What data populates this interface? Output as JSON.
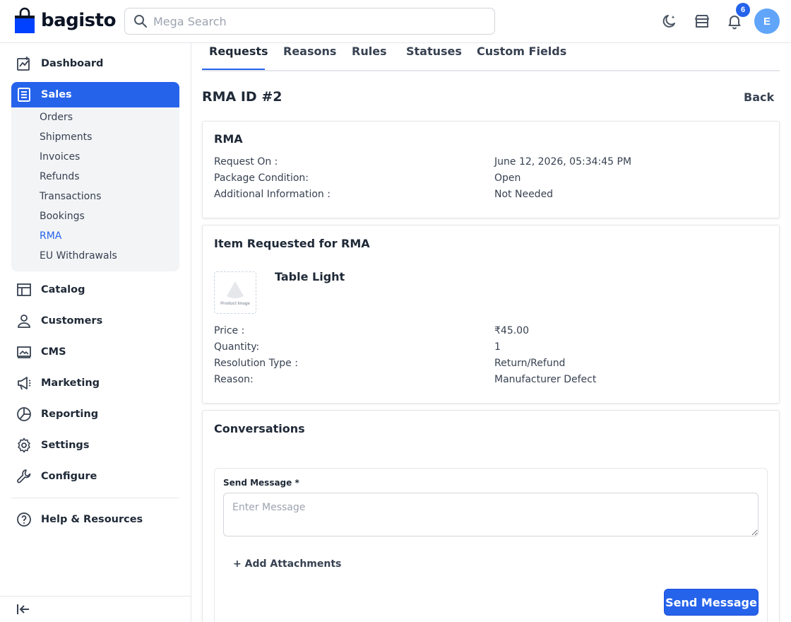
{
  "header": {
    "brand": "bagisto",
    "search_placeholder": "Mega Search",
    "notification_count": "6",
    "avatar_initial": "E",
    "icons": [
      "moon-icon",
      "store-icon",
      "bell-icon"
    ]
  },
  "sidebar": {
    "items": [
      {
        "label": "Dashboard",
        "icon": "dashboard-icon"
      },
      {
        "label": "Sales",
        "icon": "sales-icon",
        "active": true
      },
      {
        "label": "Catalog",
        "icon": "catalog-icon"
      },
      {
        "label": "Customers",
        "icon": "customers-icon"
      },
      {
        "label": "CMS",
        "icon": "cms-icon"
      },
      {
        "label": "Marketing",
        "icon": "marketing-icon"
      },
      {
        "label": "Reporting",
        "icon": "reporting-icon"
      },
      {
        "label": "Settings",
        "icon": "settings-icon"
      },
      {
        "label": "Configure",
        "icon": "configure-icon"
      },
      {
        "label": "Help & Resources",
        "icon": "help-icon"
      }
    ],
    "sales_submenu": [
      "Orders",
      "Shipments",
      "Invoices",
      "Refunds",
      "Transactions",
      "Bookings",
      "RMA",
      "EU Withdrawals"
    ],
    "active_submenu": "RMA"
  },
  "tabs": [
    "Requests",
    "Reasons",
    "Rules",
    "Statuses",
    "Custom Fields"
  ],
  "active_tab": "Requests",
  "page": {
    "title": "RMA ID #2",
    "back_label": "Back"
  },
  "rma_card": {
    "title": "RMA",
    "rows": [
      {
        "label": "Request On :",
        "value": "June 12, 2026, 05:34:45 PM"
      },
      {
        "label": "Package Condition:",
        "value": "Open"
      },
      {
        "label": "Additional Information :",
        "value": "Not Needed"
      }
    ]
  },
  "item_card": {
    "title": "Item Requested for RMA",
    "product_name": "Table Light",
    "image_placeholder": "Product Image",
    "rows": [
      {
        "label": "Price :",
        "value": "₹45.00"
      },
      {
        "label": "Quantity:",
        "value": "1"
      },
      {
        "label": "Resolution Type :",
        "value": "Return/Refund"
      },
      {
        "label": "Reason:",
        "value": "Manufacturer Defect"
      }
    ]
  },
  "conversations": {
    "title": "Conversations",
    "send_label": "Send Message *",
    "message_placeholder": "Enter Message",
    "add_attachments": "+ Add Attachments",
    "send_button": "Send Message"
  },
  "colors": {
    "accent": "#2563eb",
    "avatar": "#60a5fa"
  }
}
